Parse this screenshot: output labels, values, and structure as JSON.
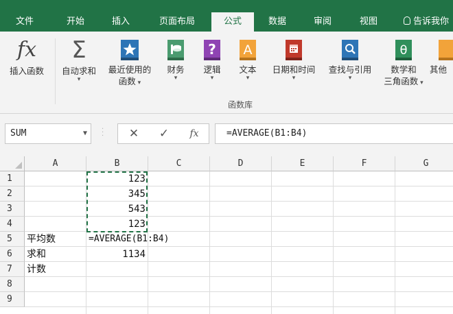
{
  "tabs": [
    {
      "label": "文件"
    },
    {
      "label": "开始"
    },
    {
      "label": "插入"
    },
    {
      "label": "页面布局"
    },
    {
      "label": "公式"
    },
    {
      "label": "数据"
    },
    {
      "label": "审阅"
    },
    {
      "label": "视图"
    }
  ],
  "tell_me": "告诉我你",
  "ribbon": {
    "insert_function": {
      "label": "插入函数",
      "icon": "fx"
    },
    "autosum": {
      "label": "自动求和",
      "icon": "Σ"
    },
    "recent": {
      "label1": "最近使用的",
      "label2": "函数"
    },
    "financial": {
      "label": "财务"
    },
    "logical": {
      "label": "逻辑",
      "icon": "?"
    },
    "text": {
      "label": "文本",
      "icon": "A"
    },
    "datetime": {
      "label": "日期和时间"
    },
    "lookup": {
      "label": "查找与引用"
    },
    "math": {
      "label1": "数学和",
      "label2": "三角函数",
      "icon": "θ"
    },
    "more": {
      "label": "其他"
    },
    "group_label": "函数库"
  },
  "colors": {
    "brand": "#217346",
    "star_blue": "#2e75b6",
    "finance_green": "#4a9b6f",
    "logic_purple": "#8f44b3",
    "text_orange": "#f2a33a",
    "datetime_red": "#c0392b",
    "lookup_blue": "#2e75b6",
    "math_green": "#2f8f5b",
    "more_orange": "#f2a33a"
  },
  "formula_bar": {
    "name_box": "SUM",
    "cancel": "✕",
    "enter": "✓",
    "fx": "fx",
    "formula": "=AVERAGE(B1:B4)"
  },
  "columns": [
    "A",
    "B",
    "C",
    "D",
    "E",
    "F",
    "G"
  ],
  "rows": [
    "1",
    "2",
    "3",
    "4",
    "5",
    "6",
    "7",
    "8",
    "9"
  ],
  "cells": {
    "B1": "123",
    "B2": "345",
    "B3": "543",
    "B4": "123",
    "A5": "平均数",
    "B5": "=AVERAGE(B1:B4)",
    "A6": "求和",
    "B6": "1134",
    "A7": "计数"
  }
}
